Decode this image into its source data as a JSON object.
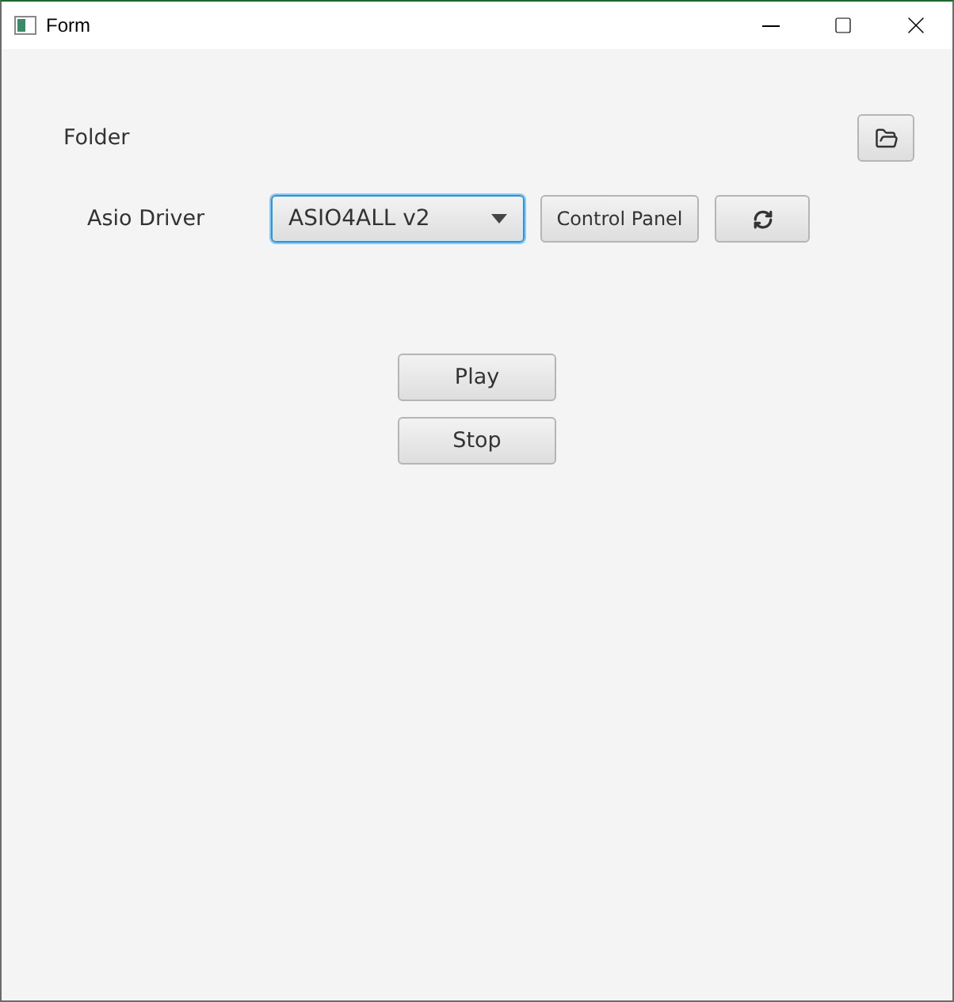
{
  "window": {
    "title": "Form"
  },
  "folder": {
    "label": "Folder"
  },
  "driver": {
    "label": "Asio Driver",
    "value": "ASIO4ALL v2",
    "focused": true,
    "control_panel": "Control Panel"
  },
  "buttons": [
    "Play",
    "Stop"
  ]
}
